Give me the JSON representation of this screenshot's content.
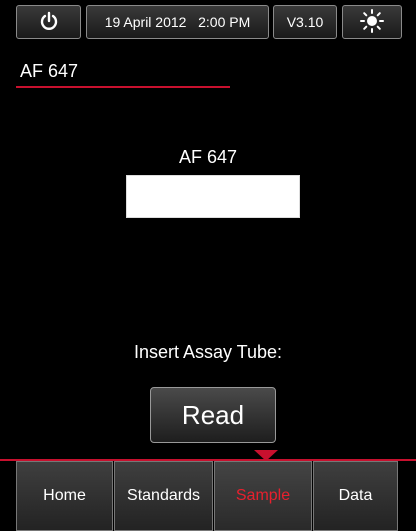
{
  "top_bar": {
    "power_icon": "power-icon",
    "datetime": "19 April 2012   2:00 PM",
    "version": "V3.10",
    "brightness_icon": "sun-icon"
  },
  "page_title": "AF 647",
  "main": {
    "sample_label": "AF 647",
    "sample_value": "",
    "prompt": "Insert Assay Tube:",
    "read_label": "Read"
  },
  "nav": {
    "items": [
      {
        "label": "Home"
      },
      {
        "label": "Standards"
      },
      {
        "label": "Sample"
      },
      {
        "label": "Data"
      }
    ],
    "active": "Sample"
  },
  "colors": {
    "accent": "#c8102e",
    "active_text": "#e8202e",
    "background": "#000000"
  }
}
